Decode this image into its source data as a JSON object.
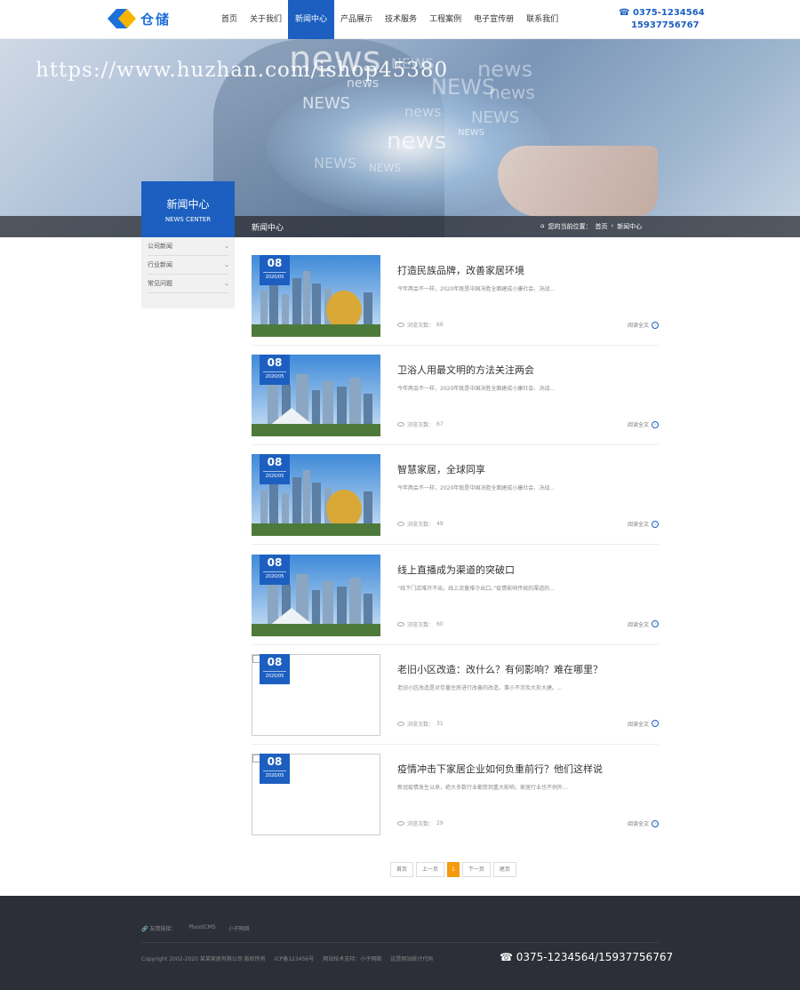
{
  "logo": {
    "text": "仓储",
    "colors": {
      "primary": "#1e6fd9",
      "accent": "#f5b400"
    }
  },
  "nav": {
    "items": [
      "首页",
      "关于我们",
      "新闻中心",
      "产品展示",
      "技术服务",
      "工程案例",
      "电子宣传册",
      "联系我们"
    ],
    "active": 2
  },
  "phones": {
    "line1": "☎ 0375-1234564",
    "line2": "15937756767"
  },
  "banner": {
    "words": [
      "news",
      "NEWS",
      "news",
      "news",
      "NEWS",
      "news",
      "NEWS",
      "news",
      "NEWS",
      "news",
      "NEWS",
      "NEWS",
      "NEWS"
    ],
    "watermark": "https://www.huzhan.com/ishop45380"
  },
  "crumbbar": {
    "title": "新闻中心",
    "location_label": "您的当前位置：",
    "items": [
      "首页",
      "新闻中心"
    ],
    "separator": "›"
  },
  "sidebar": {
    "title": "新闻中心",
    "subtitle": "NEWS CENTER",
    "items": [
      "公司新闻",
      "行业新闻",
      "常见问题"
    ]
  },
  "news": [
    {
      "day": "08",
      "ym": "2020/05",
      "title": "打造民族品牌，改善家居环境",
      "desc": "今年两会不一样，2020年既是中国决胜全面建成小康社会、决战...",
      "views_label": "浏览次数：",
      "views": "66",
      "more": "阅读全文",
      "thumb": "city1"
    },
    {
      "day": "08",
      "ym": "2020/05",
      "title": "卫浴人用最文明的方法关注两会",
      "desc": "今年两会不一样，2020年既是中国决胜全面建成小康社会、决战...",
      "views_label": "浏览次数：",
      "views": "67",
      "more": "阅读全文",
      "thumb": "city2"
    },
    {
      "day": "08",
      "ym": "2020/05",
      "title": "智慧家居，全球同享",
      "desc": "今年两会不一样，2020年既是中国决胜全面建成小康社会、决战...",
      "views_label": "浏览次数：",
      "views": "49",
      "more": "阅读全文",
      "thumb": "city1"
    },
    {
      "day": "08",
      "ym": "2020/05",
      "title": "线上直播成为渠道的突破口",
      "desc": "“线下门店难开不出，线上流量难守出口。”疫情影响传统的渠道的...",
      "views_label": "浏览次数：",
      "views": "60",
      "more": "阅读全文",
      "thumb": "city2"
    },
    {
      "day": "08",
      "ym": "2020/05",
      "title": "老旧小区改造：改什么？有何影响？难在哪里？",
      "desc": "老旧小区改造是对存量住房进行改善的改造，事小不涉及大拆大建。...",
      "views_label": "浏览次数：",
      "views": "31",
      "more": "阅读全文",
      "thumb": "broken"
    },
    {
      "day": "08",
      "ym": "2020/05",
      "title": "疫情冲击下家居企业如何负重前行？他们这样说",
      "desc": "新冠疫情发生以来，绝大多数行业都受到重大影响，家居行业也不例外...",
      "views_label": "浏览次数：",
      "views": "29",
      "more": "阅读全文",
      "thumb": "broken"
    }
  ],
  "pager": {
    "first": "首页",
    "prev": "上一页",
    "current": "1",
    "next": "下一页",
    "last": "尾页"
  },
  "footer": {
    "links_label": "友情链接：",
    "links": [
      "PbootCMS",
      "小子网络"
    ],
    "copyright": "Copyright 2002-2020 某某家居有限公司 版权所有",
    "icp": "ICP备123456号",
    "support_label": "网站技术支持：",
    "support": "小子网络",
    "stats": "这是网站统计代码",
    "phone": "☎ 0375-1234564/15937756767"
  },
  "colors": {
    "brand": "#1c5fc0",
    "pager_active": "#f59a0c",
    "footer_bg": "#2c2f37"
  }
}
